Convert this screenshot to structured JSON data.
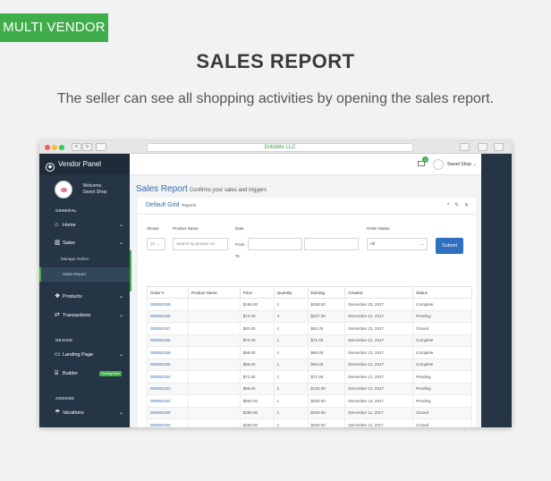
{
  "badge": "MULTI VENDOR",
  "headline": "SALES REPORT",
  "subline": "The seller can see all shopping activities by opening the sales report.",
  "browser": {
    "url": "Dribbble LLC",
    "back": "<",
    "forward": ">"
  },
  "sidebar": {
    "brand": "Vendor Panel",
    "welcome": "Welcome,",
    "user": "Sweet Shop",
    "general_label": "GENERAL",
    "design_label": "DESIGN",
    "addons_label": "ADDONS",
    "items": [
      {
        "label": "Home",
        "icon": "home-icon"
      },
      {
        "label": "Sales",
        "icon": "bar-chart-icon"
      },
      {
        "label": "Manage Orders"
      },
      {
        "label": "Sales Report"
      },
      {
        "label": "Products",
        "icon": "cubes-icon"
      },
      {
        "label": "Transactions",
        "icon": "exchange-icon"
      },
      {
        "label": "Landing Page",
        "icon": "laptop-icon"
      },
      {
        "label": "Builder",
        "icon": "bank-icon",
        "tag": "Coming Soon"
      },
      {
        "label": "Vacations",
        "icon": "umbrella-icon"
      }
    ]
  },
  "topbar": {
    "mail_count": "3",
    "shop_name": "Sweet Shop"
  },
  "page": {
    "title": "Sales Report",
    "subtitle": "Confirms your sales and triggers"
  },
  "panel": {
    "title": "Default Grid",
    "crumb": "Reports",
    "tools": "^ ✎ ✕",
    "filters": {
      "shows_label": "Shows",
      "shows_value": "10",
      "product_label": "Product Name",
      "product_placeholder": "Search by product na",
      "date_label": "Date",
      "from_label": "From",
      "to_label": "To",
      "status_label": "Order Status",
      "status_value": "All",
      "submit_label": "Submit"
    },
    "table": {
      "headers": [
        "Order #",
        "Product Name",
        "Price",
        "Quantity",
        "Earning",
        "Created",
        "Status"
      ],
      "rows": [
        [
          "000000159",
          "",
          "$155.00",
          "1",
          "$158.00",
          "December 20, 2017",
          "Complete"
        ],
        [
          "000000158",
          "",
          "$73.00",
          "4",
          "$227.20",
          "December 21, 2017",
          "Pending"
        ],
        [
          "000000157",
          "",
          "$81.00",
          "1",
          "$81.00",
          "December 21, 2017",
          "Closed"
        ],
        [
          "000000156",
          "",
          "$73.00",
          "1",
          "$71.00",
          "December 21, 2017",
          "Complete"
        ],
        [
          "000000156",
          "",
          "$66.00",
          "1",
          "$66.00",
          "December 21, 2017",
          "Complete"
        ],
        [
          "000000155",
          "",
          "$66.00",
          "1",
          "$66.00",
          "December 21, 2017",
          "Complete"
        ],
        [
          "000000154",
          "",
          "$71.00",
          "1",
          "$71.00",
          "December 21, 2017",
          "Pending"
        ],
        [
          "000000153",
          "",
          "$66.00",
          "2",
          "$132.00",
          "December 21, 2017",
          "Pending"
        ],
        [
          "000000152",
          "",
          "$500.00",
          "1",
          "$400.00",
          "December 14, 2017",
          "Pending"
        ],
        [
          "000000150",
          "",
          "$250.00",
          "1",
          "$200.00",
          "December 11, 2017",
          "Closed"
        ],
        [
          "000000150",
          "",
          "$250.00",
          "1",
          "$200.00",
          "December 11, 2017",
          "Closed"
        ],
        [
          "000000149",
          "",
          "$250.00",
          "1",
          "$200.00",
          "December 11, 2017",
          "Pending"
        ]
      ]
    }
  },
  "colors": {
    "accent_green": "#3fae4a",
    "sidebar": "#263545",
    "link_blue": "#3a6aa6",
    "button_blue": "#2f6fc0"
  }
}
